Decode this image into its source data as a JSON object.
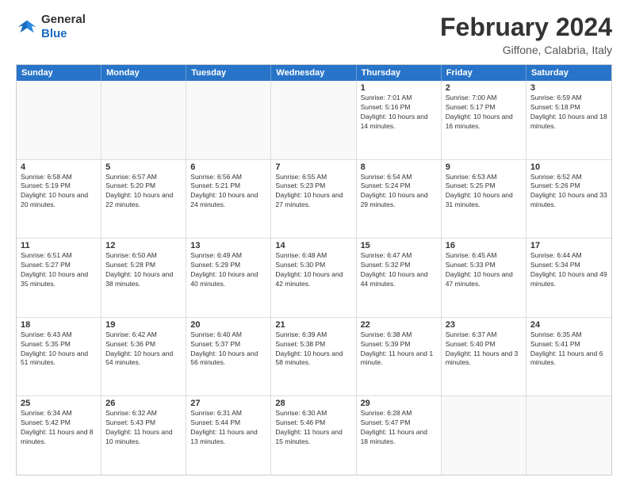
{
  "header": {
    "logo_general": "General",
    "logo_blue": "Blue",
    "month_title": "February 2024",
    "subtitle": "Giffone, Calabria, Italy"
  },
  "calendar": {
    "days_of_week": [
      "Sunday",
      "Monday",
      "Tuesday",
      "Wednesday",
      "Thursday",
      "Friday",
      "Saturday"
    ],
    "weeks": [
      [
        {
          "day": "",
          "empty": true
        },
        {
          "day": "",
          "empty": true
        },
        {
          "day": "",
          "empty": true
        },
        {
          "day": "",
          "empty": true
        },
        {
          "day": "1",
          "sunrise": "7:01 AM",
          "sunset": "5:16 PM",
          "daylight": "10 hours and 14 minutes."
        },
        {
          "day": "2",
          "sunrise": "7:00 AM",
          "sunset": "5:17 PM",
          "daylight": "10 hours and 16 minutes."
        },
        {
          "day": "3",
          "sunrise": "6:59 AM",
          "sunset": "5:18 PM",
          "daylight": "10 hours and 18 minutes."
        }
      ],
      [
        {
          "day": "4",
          "sunrise": "6:58 AM",
          "sunset": "5:19 PM",
          "daylight": "10 hours and 20 minutes."
        },
        {
          "day": "5",
          "sunrise": "6:57 AM",
          "sunset": "5:20 PM",
          "daylight": "10 hours and 22 minutes."
        },
        {
          "day": "6",
          "sunrise": "6:56 AM",
          "sunset": "5:21 PM",
          "daylight": "10 hours and 24 minutes."
        },
        {
          "day": "7",
          "sunrise": "6:55 AM",
          "sunset": "5:23 PM",
          "daylight": "10 hours and 27 minutes."
        },
        {
          "day": "8",
          "sunrise": "6:54 AM",
          "sunset": "5:24 PM",
          "daylight": "10 hours and 29 minutes."
        },
        {
          "day": "9",
          "sunrise": "6:53 AM",
          "sunset": "5:25 PM",
          "daylight": "10 hours and 31 minutes."
        },
        {
          "day": "10",
          "sunrise": "6:52 AM",
          "sunset": "5:26 PM",
          "daylight": "10 hours and 33 minutes."
        }
      ],
      [
        {
          "day": "11",
          "sunrise": "6:51 AM",
          "sunset": "5:27 PM",
          "daylight": "10 hours and 35 minutes."
        },
        {
          "day": "12",
          "sunrise": "6:50 AM",
          "sunset": "5:28 PM",
          "daylight": "10 hours and 38 minutes."
        },
        {
          "day": "13",
          "sunrise": "6:49 AM",
          "sunset": "5:29 PM",
          "daylight": "10 hours and 40 minutes."
        },
        {
          "day": "14",
          "sunrise": "6:48 AM",
          "sunset": "5:30 PM",
          "daylight": "10 hours and 42 minutes."
        },
        {
          "day": "15",
          "sunrise": "6:47 AM",
          "sunset": "5:32 PM",
          "daylight": "10 hours and 44 minutes."
        },
        {
          "day": "16",
          "sunrise": "6:45 AM",
          "sunset": "5:33 PM",
          "daylight": "10 hours and 47 minutes."
        },
        {
          "day": "17",
          "sunrise": "6:44 AM",
          "sunset": "5:34 PM",
          "daylight": "10 hours and 49 minutes."
        }
      ],
      [
        {
          "day": "18",
          "sunrise": "6:43 AM",
          "sunset": "5:35 PM",
          "daylight": "10 hours and 51 minutes."
        },
        {
          "day": "19",
          "sunrise": "6:42 AM",
          "sunset": "5:36 PM",
          "daylight": "10 hours and 54 minutes."
        },
        {
          "day": "20",
          "sunrise": "6:40 AM",
          "sunset": "5:37 PM",
          "daylight": "10 hours and 56 minutes."
        },
        {
          "day": "21",
          "sunrise": "6:39 AM",
          "sunset": "5:38 PM",
          "daylight": "10 hours and 58 minutes."
        },
        {
          "day": "22",
          "sunrise": "6:38 AM",
          "sunset": "5:39 PM",
          "daylight": "11 hours and 1 minute."
        },
        {
          "day": "23",
          "sunrise": "6:37 AM",
          "sunset": "5:40 PM",
          "daylight": "11 hours and 3 minutes."
        },
        {
          "day": "24",
          "sunrise": "6:35 AM",
          "sunset": "5:41 PM",
          "daylight": "11 hours and 6 minutes."
        }
      ],
      [
        {
          "day": "25",
          "sunrise": "6:34 AM",
          "sunset": "5:42 PM",
          "daylight": "11 hours and 8 minutes."
        },
        {
          "day": "26",
          "sunrise": "6:32 AM",
          "sunset": "5:43 PM",
          "daylight": "11 hours and 10 minutes."
        },
        {
          "day": "27",
          "sunrise": "6:31 AM",
          "sunset": "5:44 PM",
          "daylight": "11 hours and 13 minutes."
        },
        {
          "day": "28",
          "sunrise": "6:30 AM",
          "sunset": "5:46 PM",
          "daylight": "11 hours and 15 minutes."
        },
        {
          "day": "29",
          "sunrise": "6:28 AM",
          "sunset": "5:47 PM",
          "daylight": "11 hours and 18 minutes."
        },
        {
          "day": "",
          "empty": true
        },
        {
          "day": "",
          "empty": true
        }
      ]
    ]
  }
}
